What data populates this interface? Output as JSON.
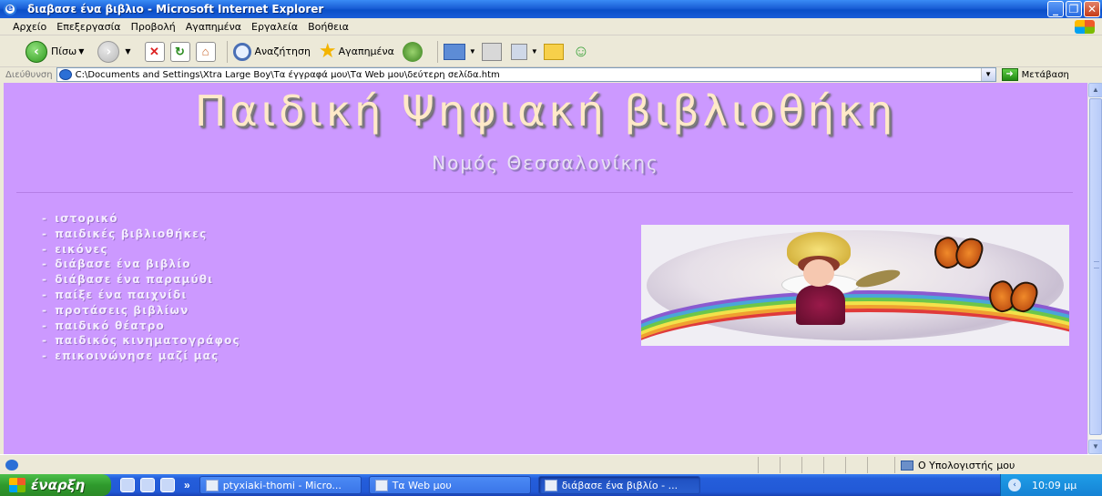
{
  "window": {
    "title": "διαβασε ένα βιβλιο - Microsoft Internet Explorer",
    "buttons": [
      "_",
      "❐",
      "✕"
    ]
  },
  "menu": [
    "Αρχείο",
    "Επεξεργασία",
    "Προβολή",
    "Αγαπημένα",
    "Εργαλεία",
    "Βοήθεια"
  ],
  "toolbar": {
    "back_label": "Πίσω",
    "search_label": "Αναζήτηση",
    "favorites_label": "Αγαπημένα"
  },
  "address": {
    "label": "Διεύθυνση",
    "value": "C:\\Documents and Settings\\Xtra Large Boy\\Τα έγγραφά μου\\Τα Web μου\\δεύτερη σελίδα.htm",
    "go_label": "Μετάβαση"
  },
  "page": {
    "title": "Παιδική Ψηφιακή βιβλιοθήκη",
    "subtitle": "Νομός Θεσσαλονίκης",
    "nav": [
      "ιστορικό",
      "παιδικές βιβλιοθήκες",
      "εικόνες",
      "διάβασε ένα βιβλίο",
      "διάβασε ένα παραμύθι",
      "παίξε ένα παιχνίδι",
      "προτάσεις βιβλίων",
      "παιδικό θέατρο",
      "παιδικός κινηματογράφος",
      "επικοινώνησε μαζί μας"
    ]
  },
  "status": {
    "zone": "Ο Υπολογιστής μου"
  },
  "taskbar": {
    "start_label": "έναρξη",
    "more": "»",
    "tasks": [
      "ptyxiaki-thomi - Micro...",
      "Τα Web μου",
      "διάβασε ένα βιβλίο - ..."
    ],
    "clock": "10:09 μμ"
  }
}
